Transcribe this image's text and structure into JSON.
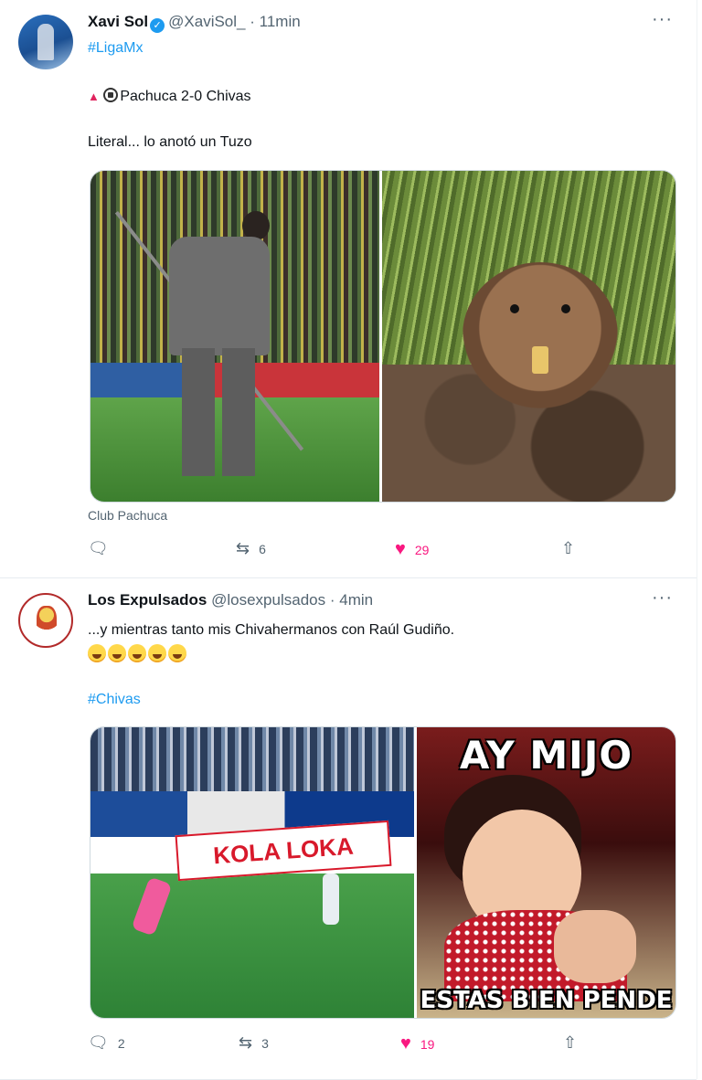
{
  "tweets": [
    {
      "name": "Xavi Sol",
      "handle": "@XaviSol_",
      "time": "11min",
      "hashtag": "#LigaMx",
      "score_line": "Pachuca 2-0 Chivas",
      "text": "Literal... lo anotó un Tuzo",
      "source": "Club Pachuca",
      "reply_count": "",
      "retweet_count": "6",
      "like_count": "29"
    },
    {
      "name": "Los Expulsados",
      "handle": "@losexpulsados",
      "time": "4min",
      "text": "...y mientras tanto mis Chivahermanos con Raúl Gudiño.",
      "hashtag": "#Chivas",
      "reply_count": "2",
      "retweet_count": "3",
      "like_count": "19",
      "ad_text": "KOLA LOKA",
      "meme_top": "AY MIJO",
      "meme_bottom": "ESTAS BIEN PENDE"
    }
  ],
  "ui": {
    "dot": "·",
    "more": "···"
  },
  "icons": {
    "reply": "speech-bubble",
    "retweet": "retweet-arrows",
    "like": "heart",
    "share": "share-arrow",
    "verified": "check-badge"
  },
  "colors": {
    "accent": "#1d9bf0",
    "like": "#f91880",
    "muted": "#536471"
  }
}
